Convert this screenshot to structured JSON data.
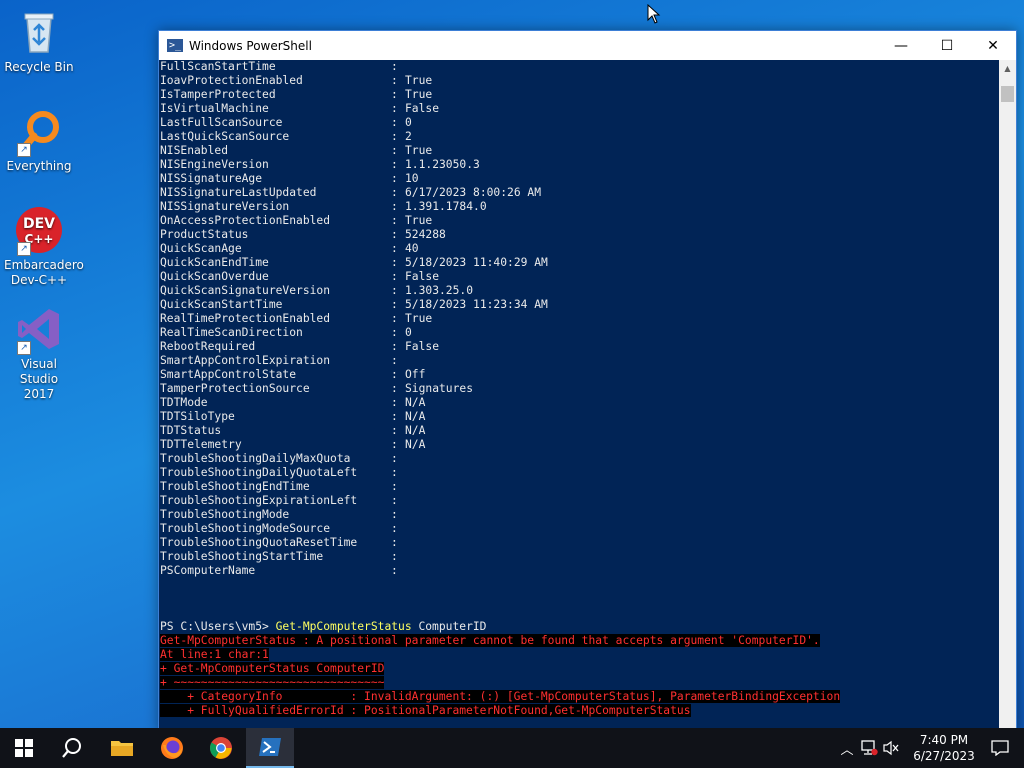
{
  "desktop": {
    "icons": [
      {
        "label": "Recycle Bin"
      },
      {
        "label": "Everything"
      },
      {
        "label": "Embarcadero Dev-C++",
        "logo_text": "DEV C++"
      },
      {
        "label": "Visual Studio 2017"
      }
    ]
  },
  "window": {
    "title": "Windows PowerShell",
    "minimize_glyph": "—",
    "maximize_glyph": "☐",
    "close_glyph": "✕"
  },
  "console": {
    "properties": [
      {
        "key": "FullScanStartTime",
        "value": ""
      },
      {
        "key": "IoavProtectionEnabled",
        "value": "True"
      },
      {
        "key": "IsTamperProtected",
        "value": "True"
      },
      {
        "key": "IsVirtualMachine",
        "value": "False"
      },
      {
        "key": "LastFullScanSource",
        "value": "0"
      },
      {
        "key": "LastQuickScanSource",
        "value": "2"
      },
      {
        "key": "NISEnabled",
        "value": "True"
      },
      {
        "key": "NISEngineVersion",
        "value": "1.1.23050.3"
      },
      {
        "key": "NISSignatureAge",
        "value": "10"
      },
      {
        "key": "NISSignatureLastUpdated",
        "value": "6/17/2023 8:00:26 AM"
      },
      {
        "key": "NISSignatureVersion",
        "value": "1.391.1784.0"
      },
      {
        "key": "OnAccessProtectionEnabled",
        "value": "True"
      },
      {
        "key": "ProductStatus",
        "value": "524288"
      },
      {
        "key": "QuickScanAge",
        "value": "40"
      },
      {
        "key": "QuickScanEndTime",
        "value": "5/18/2023 11:40:29 AM"
      },
      {
        "key": "QuickScanOverdue",
        "value": "False"
      },
      {
        "key": "QuickScanSignatureVersion",
        "value": "1.303.25.0"
      },
      {
        "key": "QuickScanStartTime",
        "value": "5/18/2023 11:23:34 AM"
      },
      {
        "key": "RealTimeProtectionEnabled",
        "value": "True"
      },
      {
        "key": "RealTimeScanDirection",
        "value": "0"
      },
      {
        "key": "RebootRequired",
        "value": "False"
      },
      {
        "key": "SmartAppControlExpiration",
        "value": ""
      },
      {
        "key": "SmartAppControlState",
        "value": "Off"
      },
      {
        "key": "TamperProtectionSource",
        "value": "Signatures"
      },
      {
        "key": "TDTMode",
        "value": "N/A"
      },
      {
        "key": "TDTSiloType",
        "value": "N/A"
      },
      {
        "key": "TDTStatus",
        "value": "N/A"
      },
      {
        "key": "TDTTelemetry",
        "value": "N/A"
      },
      {
        "key": "TroubleShootingDailyMaxQuota",
        "value": ""
      },
      {
        "key": "TroubleShootingDailyQuotaLeft",
        "value": ""
      },
      {
        "key": "TroubleShootingEndTime",
        "value": ""
      },
      {
        "key": "TroubleShootingExpirationLeft",
        "value": ""
      },
      {
        "key": "TroubleShootingMode",
        "value": ""
      },
      {
        "key": "TroubleShootingModeSource",
        "value": ""
      },
      {
        "key": "TroubleShootingQuotaResetTime",
        "value": ""
      },
      {
        "key": "TroubleShootingStartTime",
        "value": ""
      },
      {
        "key": "PSComputerName",
        "value": ""
      }
    ],
    "separator": ":",
    "prompt": "PS C:\\Users\\vm5> ",
    "command": "Get-MpComputerStatus",
    "argument": " ComputerID",
    "errors": [
      "Get-MpComputerStatus : A positional parameter cannot be found that accepts argument 'ComputerID'.",
      "At line:1 char:1",
      "+ Get-MpComputerStatus ComputerID",
      "+ ~~~~~~~~~~~~~~~~~~~~~~~~~~~~~~~",
      "    + CategoryInfo          : InvalidArgument: (:) [Get-MpComputerStatus], ParameterBindingException",
      "    + FullyQualifiedErrorId : PositionalParameterNotFound,Get-MpComputerStatus"
    ]
  },
  "taskbar": {
    "time": "7:40 PM",
    "date": "6/27/2023",
    "colors": {
      "background": "#101218",
      "accent": "#76b9ed"
    }
  }
}
